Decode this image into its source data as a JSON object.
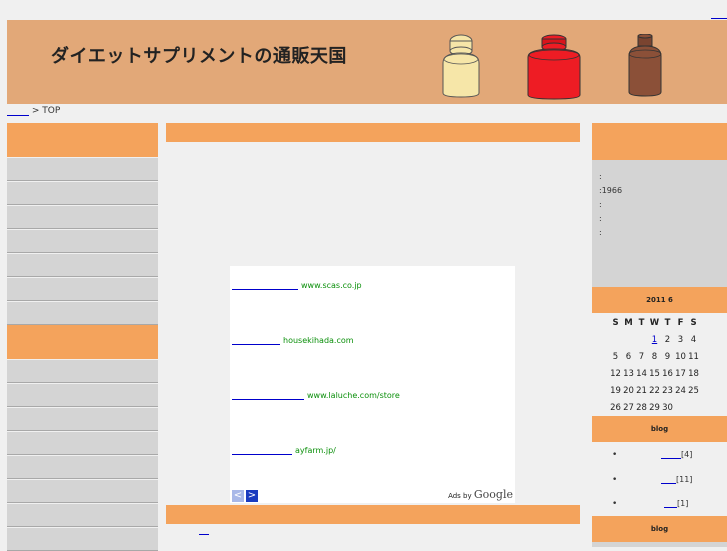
{
  "site": {
    "title": "ダイエットサプリメントの通販天国"
  },
  "colors": {
    "header": "#e2a878",
    "accent": "#f4a35c",
    "panel": "#d4d4d4",
    "ad_text": "#0a8f0a",
    "link": "#0000cc"
  },
  "breadcrumb": {
    "current": "> TOP"
  },
  "ads": {
    "items": [
      {
        "url": "www.scas.co.jp"
      },
      {
        "url": "housekihada.com"
      },
      {
        "url": "www.laluche.com/store"
      },
      {
        "url": "ayfarm.jp/"
      }
    ],
    "prev_label": "<",
    "next_label": ">",
    "ads_by": "Ads by",
    "ads_brand": "Google"
  },
  "profile": {
    "lines": [
      ":",
      ":1966",
      ":",
      ":",
      ":"
    ]
  },
  "calendar": {
    "title": "2011  6",
    "weekdays": [
      "S",
      "M",
      "T",
      "W",
      "T",
      "F",
      "S"
    ],
    "weeks": [
      [
        "",
        "",
        "",
        "1",
        "2",
        "3",
        "4"
      ],
      [
        "5",
        "6",
        "7",
        "8",
        "9",
        "10",
        "11"
      ],
      [
        "12",
        "13",
        "14",
        "15",
        "16",
        "17",
        "18"
      ],
      [
        "19",
        "20",
        "21",
        "22",
        "23",
        "24",
        "25"
      ],
      [
        "26",
        "27",
        "28",
        "29",
        "30",
        "",
        ""
      ]
    ],
    "linked_day": "1"
  },
  "blog_section": {
    "title": "blog",
    "items": [
      {
        "count": "[4]"
      },
      {
        "count": "[11]"
      },
      {
        "count": "[1]"
      }
    ]
  },
  "blog_section2": {
    "title": "blog"
  },
  "icons": {
    "bullet": "•",
    "jars": [
      "cream-jar-icon",
      "red-jar-icon",
      "brown-jar-icon"
    ]
  }
}
